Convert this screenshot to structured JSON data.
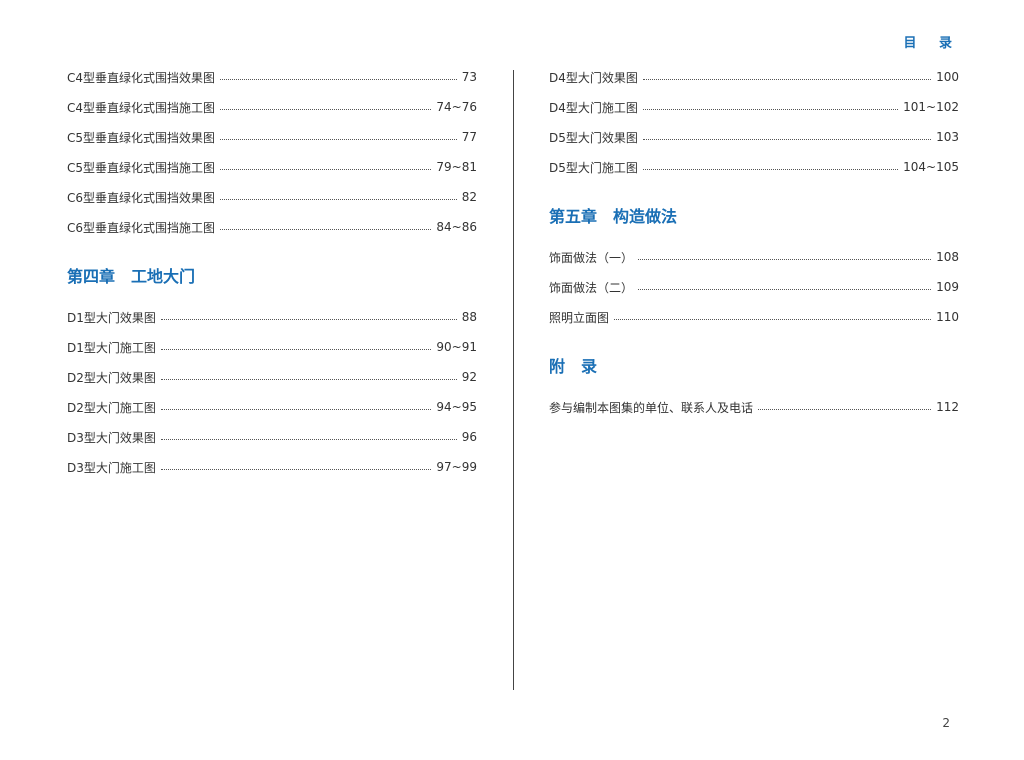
{
  "header": {
    "title": "目 录"
  },
  "left_column": {
    "entries_top": [
      {
        "label": "C4型垂直绿化式围挡效果图",
        "page": "73"
      },
      {
        "label": "C4型垂直绿化式围挡施工图",
        "page": "74~76"
      },
      {
        "label": "C5型垂直绿化式围挡效果图",
        "page": "77"
      },
      {
        "label": "C5型垂直绿化式围挡施工图",
        "page": "79~81"
      },
      {
        "label": "C6型垂直绿化式围挡效果图",
        "page": "82"
      },
      {
        "label": "C6型垂直绿化式围挡施工图",
        "page": "84~86"
      }
    ],
    "chapter_title": "第四章　工地大门",
    "entries_bottom": [
      {
        "label": "D1型大门效果图",
        "page": "88"
      },
      {
        "label": "D1型大门施工图",
        "page": "90~91"
      },
      {
        "label": "D2型大门效果图",
        "page": "92"
      },
      {
        "label": "D2型大门施工图",
        "page": "94~95"
      },
      {
        "label": "D3型大门效果图",
        "page": "96"
      },
      {
        "label": "D3型大门施工图",
        "page": "97~99"
      }
    ]
  },
  "right_column": {
    "entries_top": [
      {
        "label": "D4型大门效果图",
        "page": "100"
      },
      {
        "label": "D4型大门施工图",
        "page": "101~102"
      },
      {
        "label": "D5型大门效果图",
        "page": "103"
      },
      {
        "label": "D5型大门施工图",
        "page": "104~105"
      }
    ],
    "chapter_title": "第五章　构造做法",
    "entries_middle": [
      {
        "label": "饰面做法（一）",
        "page": "108"
      },
      {
        "label": "饰面做法（二）",
        "page": "109"
      },
      {
        "label": "照明立面图",
        "page": "110"
      }
    ],
    "appendix_title": "附　录",
    "entries_bottom": [
      {
        "label": "参与编制本图集的单位、联系人及电话",
        "page": "112"
      }
    ]
  },
  "footer": {
    "page_number": "2"
  },
  "colors": {
    "accent": "#1a6fb5",
    "text": "#333333"
  }
}
